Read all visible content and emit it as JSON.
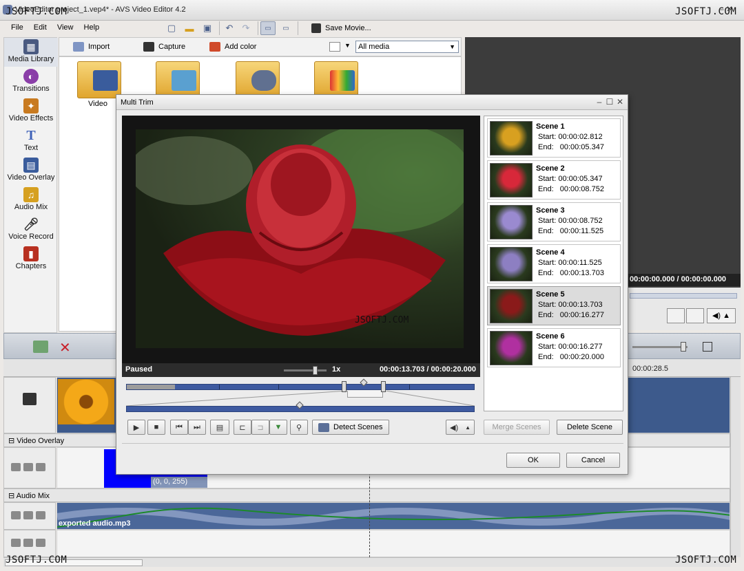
{
  "window": {
    "title": "VideoEditor project_1.vep4* - AVS Video Editor 4.2",
    "watermark": "JSOFTJ.COM"
  },
  "menu": {
    "file": "File",
    "edit": "Edit",
    "view": "View",
    "help": "Help"
  },
  "toolbar": {
    "save_movie": "Save Movie..."
  },
  "leftnav": {
    "items": [
      {
        "label": "Media Library",
        "icon": "media-library-icon",
        "color": "#4a5a80"
      },
      {
        "label": "Transitions",
        "icon": "transitions-icon",
        "color": "#8a3ea8"
      },
      {
        "label": "Video Effects",
        "icon": "video-effects-icon",
        "color": "#c87a20"
      },
      {
        "label": "Text",
        "icon": "text-icon",
        "color": "#3f62b8"
      },
      {
        "label": "Video Overlay",
        "icon": "video-overlay-icon",
        "color": "#3a5c9c"
      },
      {
        "label": "Audio Mix",
        "icon": "audio-mix-icon",
        "color": "#d6a020"
      },
      {
        "label": "Voice Record",
        "icon": "microphone-icon",
        "color": "#555555"
      },
      {
        "label": "Chapters",
        "icon": "chapters-icon",
        "color": "#b83020"
      }
    ]
  },
  "media": {
    "import": "Import",
    "capture": "Capture",
    "add_color": "Add color",
    "filter_value": "All media",
    "folders": [
      {
        "label": "Video"
      }
    ]
  },
  "preview_right": {
    "time": "00:00:00.000 / 00:00:00.000"
  },
  "timeline": {
    "ruler": [
      "00:00:28.5"
    ],
    "video_overlay_label": "Video Overlay",
    "audio_mix_label": "Audio Mix",
    "overlay_clip_label": "(0, 0, 255)",
    "audio_clip_label": "exported audio.mp3"
  },
  "dialog": {
    "title": "Multi Trim",
    "status": "Paused",
    "speed": "1x",
    "time": "00:00:13.703 / 00:00:20.000",
    "video_watermark": "JSOFTJ.COM",
    "detect_scenes": "Detect Scenes",
    "merge_scenes": "Merge Scenes",
    "delete_scene": "Delete Scene",
    "ok": "OK",
    "cancel": "Cancel",
    "start_prefix": "Start:",
    "end_prefix": "End:",
    "scenes": [
      {
        "name": "Scene 1",
        "start": "00:00:02.812",
        "end": "00:00:05.347",
        "thumb_color": "#d8a020"
      },
      {
        "name": "Scene 2",
        "start": "00:00:05.347",
        "end": "00:00:08.752",
        "thumb_color": "#d8283a"
      },
      {
        "name": "Scene 3",
        "start": "00:00:08.752",
        "end": "00:00:11.525",
        "thumb_color": "#9a8ad0"
      },
      {
        "name": "Scene 4",
        "start": "00:00:11.525",
        "end": "00:00:13.703",
        "thumb_color": "#8d7fc2"
      },
      {
        "name": "Scene 5",
        "start": "00:00:13.703",
        "end": "00:00:16.277",
        "thumb_color": "#8a1a1a"
      },
      {
        "name": "Scene 6",
        "start": "00:00:16.277",
        "end": "00:00:20.000",
        "thumb_color": "#b030a0"
      }
    ],
    "selected_scene": 4
  }
}
